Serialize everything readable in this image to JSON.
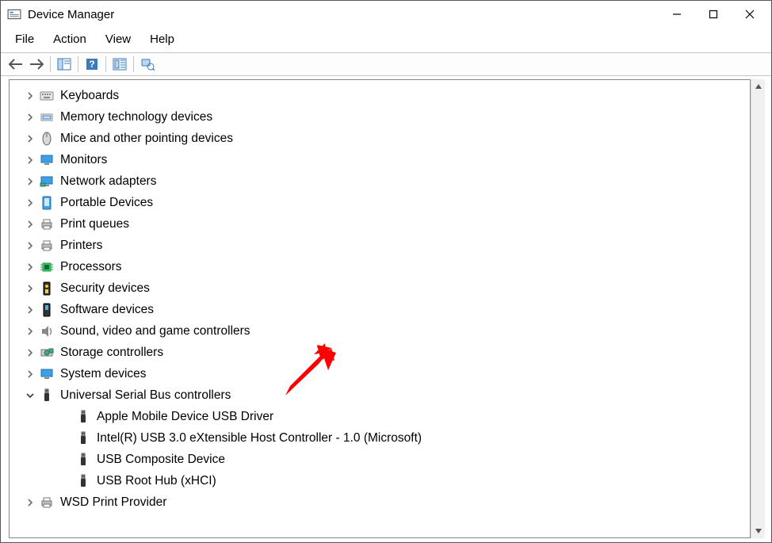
{
  "window": {
    "title": "Device Manager"
  },
  "menu": {
    "file": "File",
    "action": "Action",
    "view": "View",
    "help": "Help"
  },
  "toolbar": {
    "back": "back-icon",
    "forward": "forward-icon",
    "showhide": "show-hide-tree-icon",
    "help": "help-icon",
    "scan": "scan-hardware-icon",
    "devices": "devices-printers-icon"
  },
  "tree": {
    "items": [
      {
        "label": "Keyboards",
        "icon": "keyboard-icon",
        "expanded": false
      },
      {
        "label": "Memory technology devices",
        "icon": "memory-icon",
        "expanded": false
      },
      {
        "label": "Mice and other pointing devices",
        "icon": "mouse-icon",
        "expanded": false
      },
      {
        "label": "Monitors",
        "icon": "monitor-icon",
        "expanded": false
      },
      {
        "label": "Network adapters",
        "icon": "network-icon",
        "expanded": false
      },
      {
        "label": "Portable Devices",
        "icon": "portable-icon",
        "expanded": false
      },
      {
        "label": "Print queues",
        "icon": "printer-icon",
        "expanded": false
      },
      {
        "label": "Printers",
        "icon": "printer-icon",
        "expanded": false
      },
      {
        "label": "Processors",
        "icon": "processor-icon",
        "expanded": false
      },
      {
        "label": "Security devices",
        "icon": "security-icon",
        "expanded": false
      },
      {
        "label": "Software devices",
        "icon": "software-icon",
        "expanded": false
      },
      {
        "label": "Sound, video and game controllers",
        "icon": "sound-icon",
        "expanded": false
      },
      {
        "label": "Storage controllers",
        "icon": "storage-icon",
        "expanded": false
      },
      {
        "label": "System devices",
        "icon": "system-icon",
        "expanded": false
      },
      {
        "label": "Universal Serial Bus controllers",
        "icon": "usb-icon",
        "expanded": true,
        "children": [
          {
            "label": "Apple Mobile Device USB Driver",
            "icon": "usb-icon"
          },
          {
            "label": "Intel(R) USB 3.0 eXtensible Host Controller - 1.0 (Microsoft)",
            "icon": "usb-icon"
          },
          {
            "label": "USB Composite Device",
            "icon": "usb-icon"
          },
          {
            "label": "USB Root Hub (xHCI)",
            "icon": "usb-icon"
          }
        ]
      },
      {
        "label": "WSD Print Provider",
        "icon": "printer-icon",
        "expanded": false
      }
    ]
  }
}
